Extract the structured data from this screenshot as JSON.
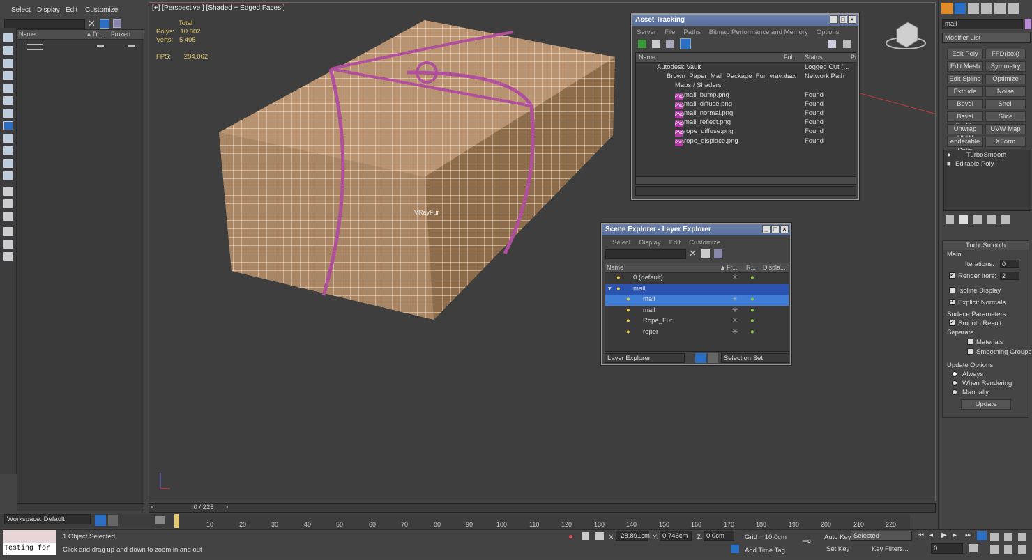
{
  "menu": {
    "select": "Select",
    "display": "Display",
    "edit": "Edit",
    "customize": "Customize"
  },
  "left_explorer": {
    "col_name": "Name",
    "col_di": "Di...",
    "col_frozen": "Frozen"
  },
  "viewport": {
    "label": "[+] [Perspective ] [Shaded + Edged Faces ]",
    "stats_total": "Total",
    "stats_polys_label": "Polys:",
    "stats_polys": "10 802",
    "stats_verts_label": "Verts:",
    "stats_verts": "5 405",
    "fps_label": "FPS:",
    "fps": "284,062",
    "object_label": "VRayFur"
  },
  "asset_tracking": {
    "title": "Asset Tracking",
    "menu": [
      "Server",
      "File",
      "Paths",
      "Bitmap Performance and Memory",
      "Options"
    ],
    "columns": [
      "Name",
      "Ful...",
      "Status",
      "Pr"
    ],
    "rows": [
      {
        "name": "Autodesk Vault",
        "full": "",
        "status": "Logged Out (..."
      },
      {
        "name": "Brown_Paper_Mail_Package_Fur_vray.max",
        "full": "\\\\...",
        "status": "Network Path"
      },
      {
        "name": "Maps / Shaders",
        "full": "",
        "status": ""
      },
      {
        "name": "mail_bump.png",
        "full": "",
        "status": "Found"
      },
      {
        "name": "mail_diffuse.png",
        "full": "",
        "status": "Found"
      },
      {
        "name": "mail_normal.png",
        "full": "",
        "status": "Found"
      },
      {
        "name": "mail_reflect.png",
        "full": "",
        "status": "Found"
      },
      {
        "name": "rope_diffuse.png",
        "full": "",
        "status": "Found"
      },
      {
        "name": "rope_displace.png",
        "full": "",
        "status": "Found"
      }
    ]
  },
  "scene_explorer": {
    "title": "Scene Explorer - Layer Explorer",
    "menu": [
      "Select",
      "Display",
      "Edit",
      "Customize"
    ],
    "columns": [
      "Name",
      "Fr...",
      "R...",
      "Displa..."
    ],
    "rows": [
      {
        "name": "0 (default)"
      },
      {
        "name": "mail"
      },
      {
        "name": "mail"
      },
      {
        "name": "mail"
      },
      {
        "name": "Rope_Fur"
      },
      {
        "name": "roper"
      }
    ],
    "footer_left": "Layer Explorer",
    "footer_right": "Selection Set:"
  },
  "right_panel": {
    "name_field": "mail",
    "modifier_list": "Modifier List",
    "buttons": [
      "Edit Poly",
      "FFD(box)",
      "Edit Mesh",
      "Symmetry",
      "Edit Spline",
      "Optimize",
      "Extrude",
      "Noise",
      "Bevel",
      "Shell",
      "Bevel Profile",
      "Slice",
      "Unwrap UVW",
      "UVW Map",
      "enderable Splin",
      "XForm"
    ],
    "stack": [
      "TurboSmooth",
      "Editable Poly"
    ],
    "turbosmooth": {
      "title": "TurboSmooth",
      "main": "Main",
      "iterations_label": "Iterations:",
      "iterations": "0",
      "render_iters_label": "Render Iters:",
      "render_iters": "2",
      "isoline": "Isoline Display",
      "explicit": "Explicit Normals",
      "surface": "Surface Parameters",
      "smooth_result": "Smooth Result",
      "separate": "Separate",
      "materials": "Materials",
      "smoothing_groups": "Smoothing Groups",
      "update_options": "Update Options",
      "always": "Always",
      "when_rendering": "When Rendering",
      "manually": "Manually",
      "update": "Update"
    }
  },
  "timeline": {
    "frame": "0 / 225",
    "ticks": [
      "10",
      "20",
      "30",
      "40",
      "50",
      "60",
      "70",
      "80",
      "90",
      "100",
      "110",
      "120",
      "130",
      "140",
      "150",
      "160",
      "170",
      "180",
      "190",
      "200",
      "210",
      "220"
    ]
  },
  "status": {
    "workspace": "Workspace: Default",
    "testing": "Testing for ;",
    "selected": "1 Object Selected",
    "prompt": "Click and drag up-and-down to zoom in and out",
    "x_label": "X:",
    "x": "-28,891cm",
    "y_label": "Y:",
    "y": "0,746cm",
    "z_label": "Z:",
    "z": "0,0cm",
    "grid": "Grid = 10,0cm",
    "add_time_tag": "Add Time Tag",
    "auto_key": "Auto Key",
    "set_key": "Set Key",
    "selected_dropdown": "Selected",
    "key_filters": "Key Filters...",
    "frame_field": "0"
  }
}
